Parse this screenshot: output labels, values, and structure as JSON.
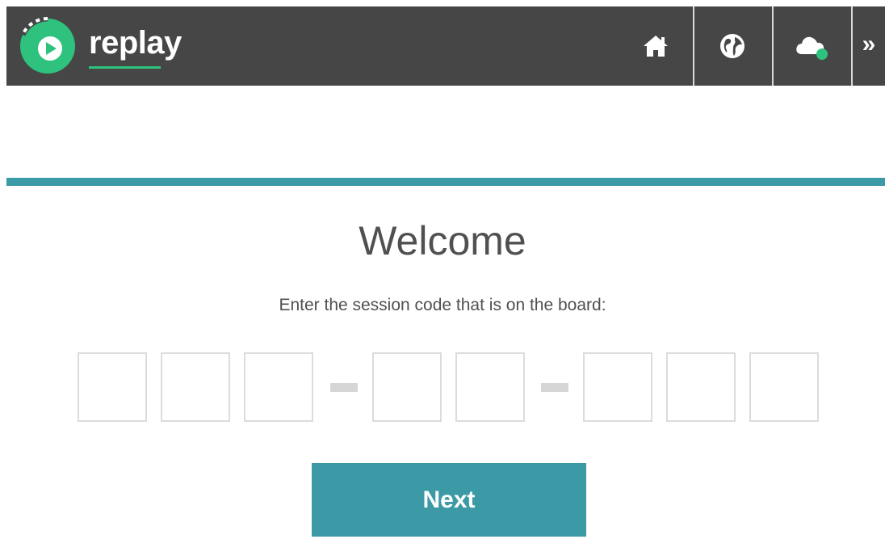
{
  "header": {
    "brand_name": "replay",
    "brand_color": "#2ec27e",
    "bar_color": "#464646",
    "nav": [
      {
        "icon": "home-icon"
      },
      {
        "icon": "globe-icon"
      },
      {
        "icon": "cloud-status-icon",
        "status_color": "#2ec27e"
      },
      {
        "icon": "double-chevron-right-icon",
        "glyph": "»"
      }
    ]
  },
  "accent_color": "#3b9aa6",
  "main": {
    "title": "Welcome",
    "prompt": "Enter the session code that is on the board:",
    "code": {
      "groups": [
        [
          "",
          "",
          ""
        ],
        [
          "",
          ""
        ],
        [
          "",
          "",
          ""
        ]
      ],
      "separator": "-"
    },
    "next_label": "Next"
  }
}
